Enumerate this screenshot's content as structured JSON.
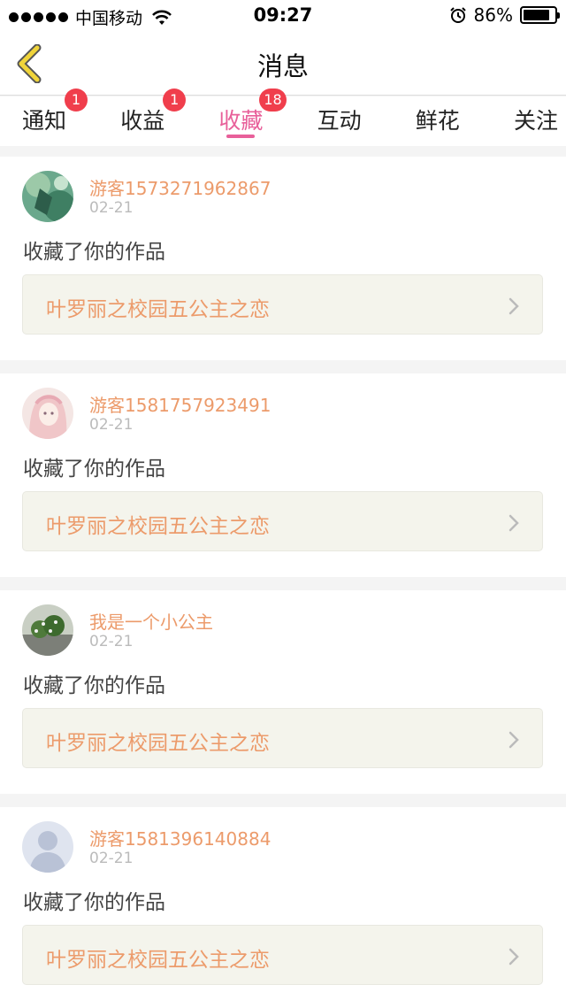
{
  "status_bar": {
    "carrier": "中国移动",
    "time": "09:27",
    "battery": "86%"
  },
  "nav": {
    "title": "消息"
  },
  "tabs": [
    {
      "label": "通知",
      "badge": "1"
    },
    {
      "label": "收益",
      "badge": "1"
    },
    {
      "label": "收藏",
      "badge": "18"
    },
    {
      "label": "互动",
      "badge": ""
    },
    {
      "label": "鲜花",
      "badge": ""
    },
    {
      "label": "关注",
      "badge": ""
    }
  ],
  "active_tab": "收藏",
  "messages": [
    {
      "username": "游客1573271962867",
      "date": "02-21",
      "action": "收藏了你的作品",
      "work": "叶罗丽之校园五公主之恋"
    },
    {
      "username": "游客1581757923491",
      "date": "02-21",
      "action": "收藏了你的作品",
      "work": "叶罗丽之校园五公主之恋"
    },
    {
      "username": "我是一个小公主",
      "date": "02-21",
      "action": "收藏了你的作品",
      "work": "叶罗丽之校园五公主之恋"
    },
    {
      "username": "游客1581396140884",
      "date": "02-21",
      "action": "收藏了你的作品",
      "work": "叶罗丽之校园五公主之恋"
    }
  ],
  "colors": {
    "accent": "#e8609a",
    "username": "#ec9b6b",
    "badge": "#f03e4c",
    "back_arrow": "#f0d43a"
  }
}
